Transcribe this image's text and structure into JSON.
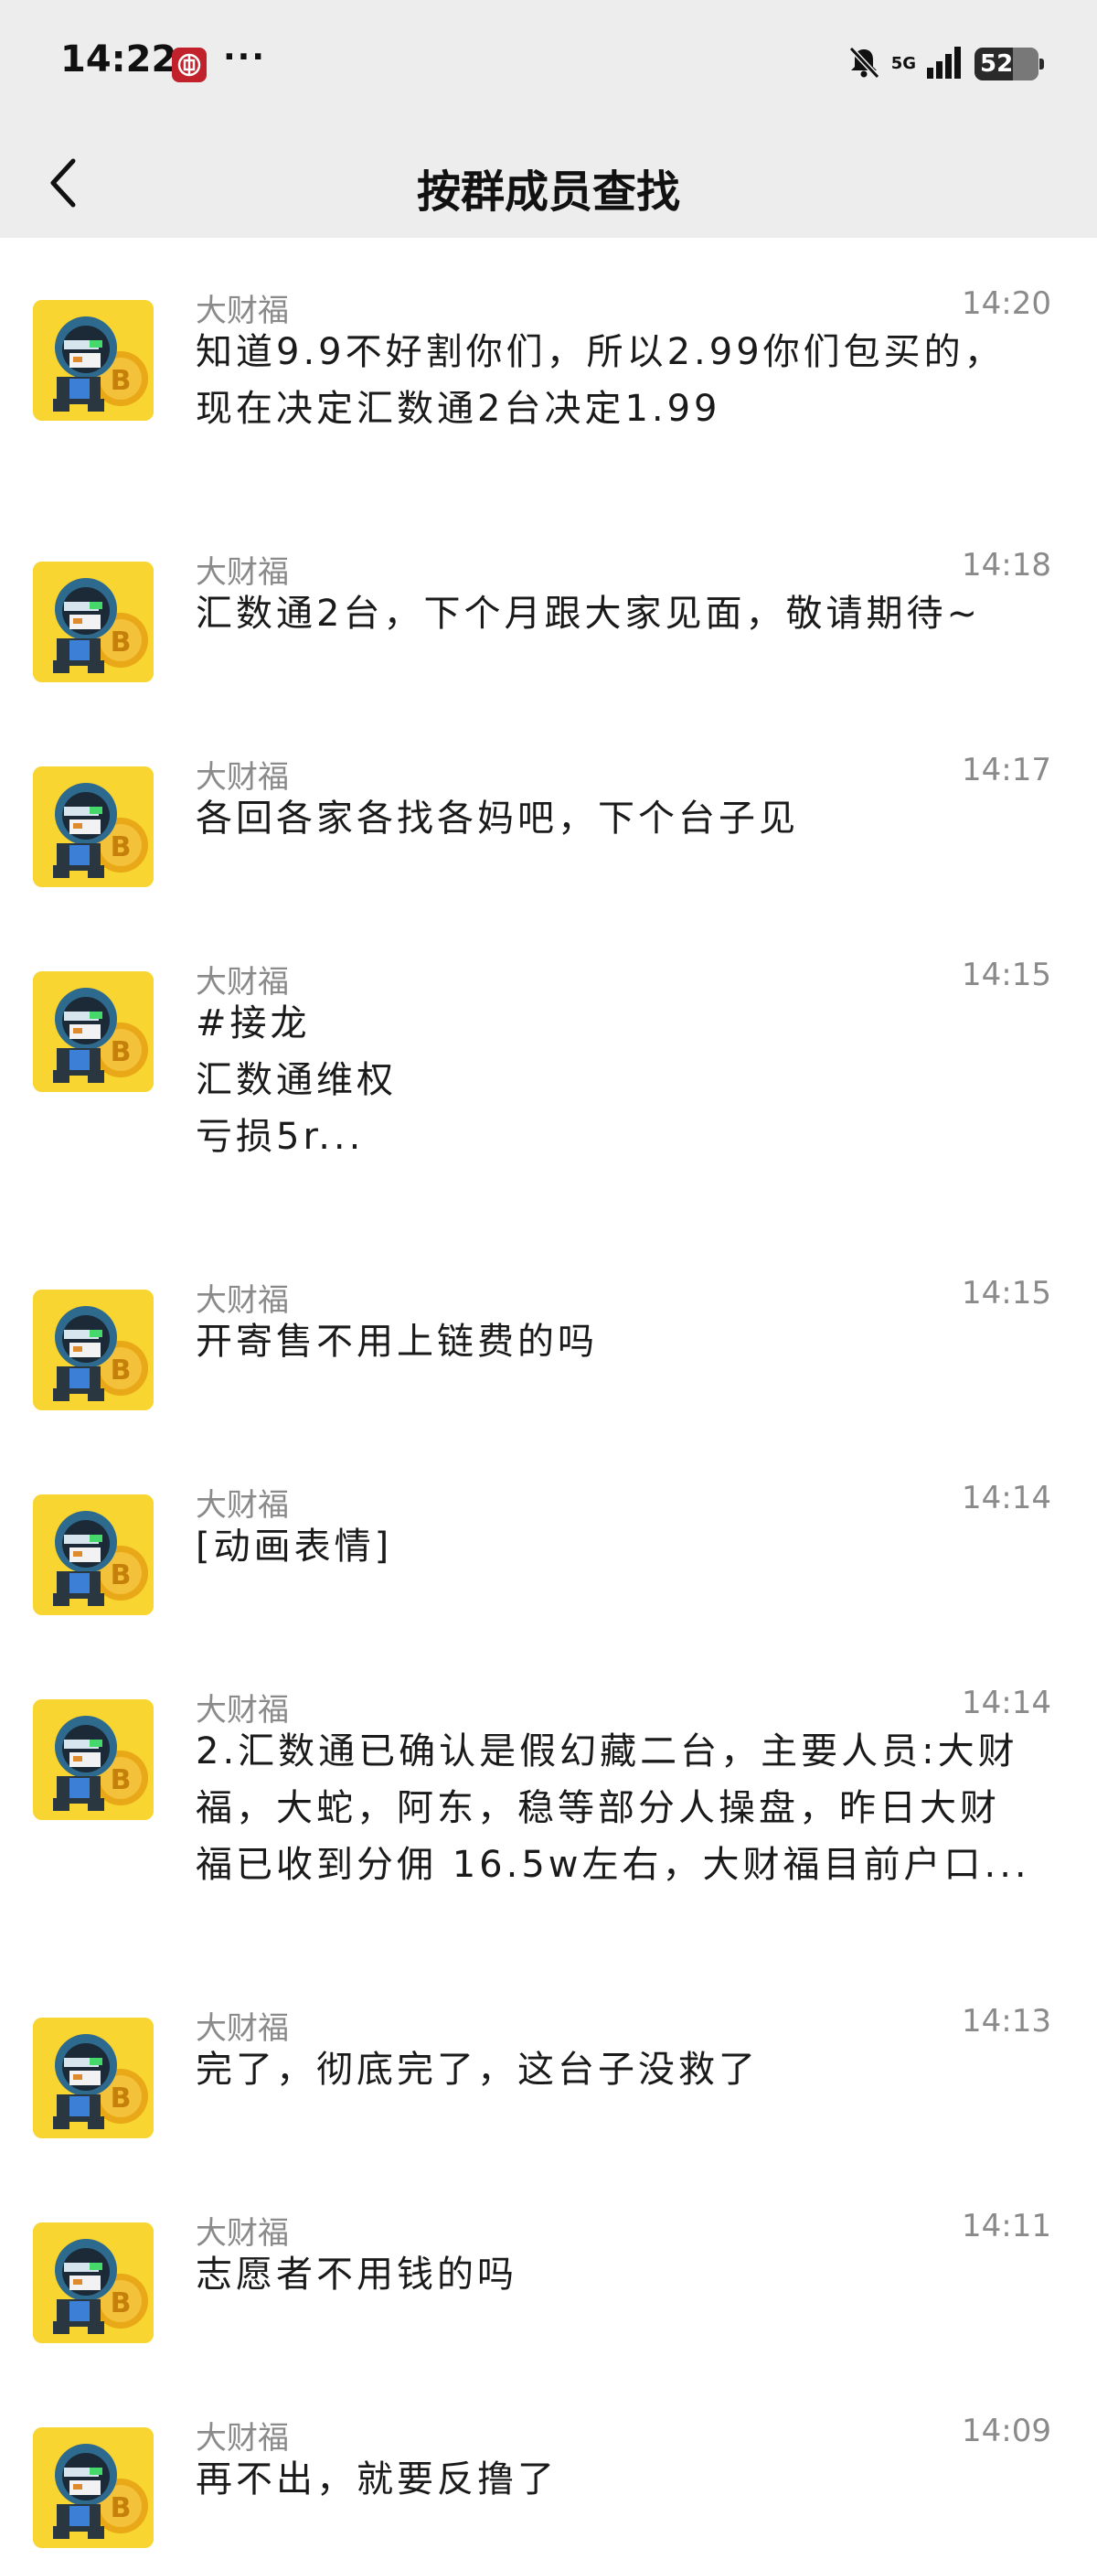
{
  "status_bar": {
    "time": "14:22",
    "more": "···",
    "network": "5G",
    "battery": "52"
  },
  "header": {
    "title": "按群成员查找"
  },
  "messages": [
    {
      "sender": "大财福",
      "time": "14:20",
      "lines": [
        "知道9.9不好割你们，所以2.99你们包买的，",
        "现在决定汇数通2台决定1.99"
      ]
    },
    {
      "sender": "大财福",
      "time": "14:18",
      "lines": [
        "汇数通2台，下个月跟大家见面，敬请期待~"
      ]
    },
    {
      "sender": "大财福",
      "time": "14:17",
      "lines": [
        "各回各家各找各妈吧，下个台子见"
      ]
    },
    {
      "sender": "大财福",
      "time": "14:15",
      "lines": [
        "#接龙",
        "汇数通维权",
        "亏损5r..."
      ]
    },
    {
      "sender": "大财福",
      "time": "14:15",
      "lines": [
        "开寄售不用上链费的吗"
      ]
    },
    {
      "sender": "大财福",
      "time": "14:14",
      "lines": [
        "[动画表情]"
      ]
    },
    {
      "sender": "大财福",
      "time": "14:14",
      "lines": [
        "2.汇数通已确认是假幻藏二台，主要人员:大财",
        "福，大蛇，阿东，稳等部分人操盘，昨日大财",
        "福已收到分佣 16.5w左右，大财福目前户口..."
      ]
    },
    {
      "sender": "大财福",
      "time": "14:13",
      "lines": [
        "完了，彻底完了，这台子没救了"
      ]
    },
    {
      "sender": "大财福",
      "time": "14:11",
      "lines": [
        "志愿者不用钱的吗"
      ]
    },
    {
      "sender": "大财福",
      "time": "14:09",
      "lines": [
        "再不出，就要反撸了"
      ]
    }
  ]
}
